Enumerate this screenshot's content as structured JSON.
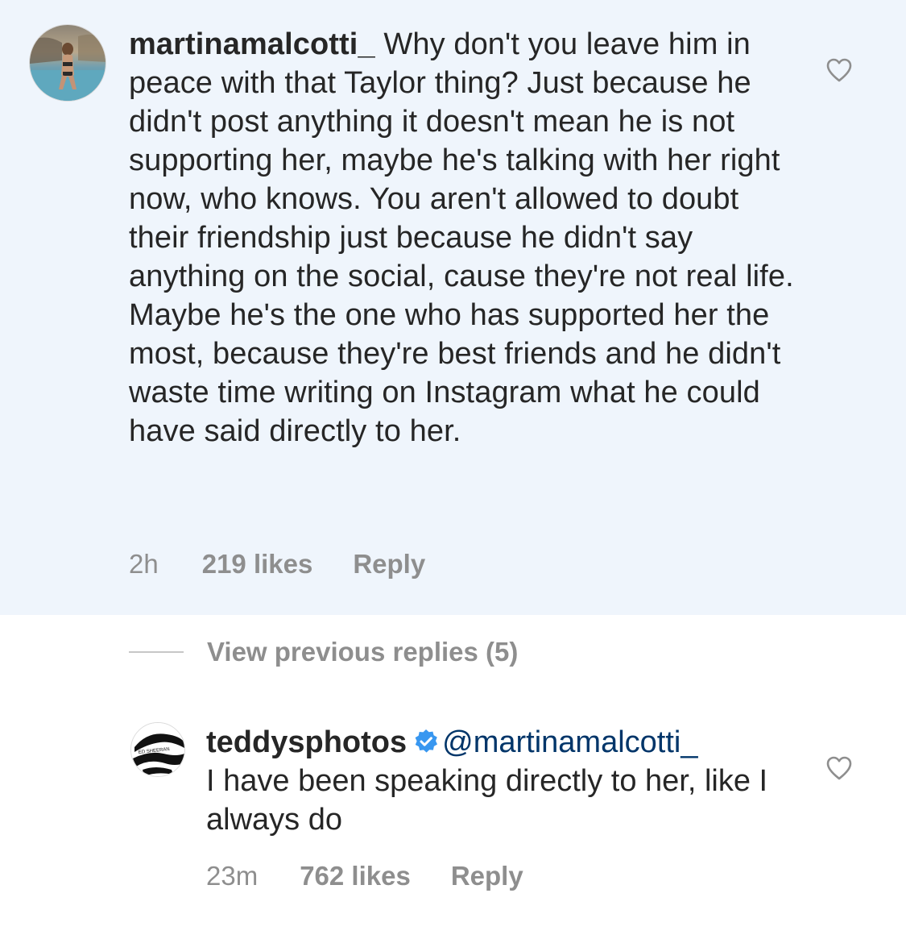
{
  "comment": {
    "username": "martinamalcotti_",
    "text": "Why don't you leave him in peace with that Taylor thing? Just because he didn't post anything it doesn't mean he is not supporting her, maybe he's talking with her right now, who knows. You aren't allowed to doubt their friendship just because he didn't say anything on the social, cause they're not real life. Maybe he's the one who has supported her the most, because they're best friends and he didn't waste time writing on Instagram what he could have said directly to her.",
    "time": "2h",
    "likes": "219 likes",
    "reply_label": "Reply",
    "icons": {
      "avatar": "profile-photo-beach",
      "like": "heart-outline-icon"
    },
    "background_color": "#eff5fc"
  },
  "view_replies": {
    "label": "View previous replies (5)"
  },
  "reply": {
    "username": "teddysphotos",
    "verified": true,
    "mention": "@martinamalcotti_",
    "text": "I have been speaking directly to her, like I always do",
    "time": "23m",
    "likes": "762 likes",
    "reply_label": "Reply",
    "avatar_text": "ED SHEERAN",
    "icons": {
      "avatar": "profile-photo-ed-sheeran",
      "verified": "verified-badge-icon",
      "like": "heart-outline-icon"
    }
  },
  "colors": {
    "text": "#262626",
    "muted": "#8e8e8e",
    "mention": "#003569",
    "verified": "#3897f0"
  }
}
